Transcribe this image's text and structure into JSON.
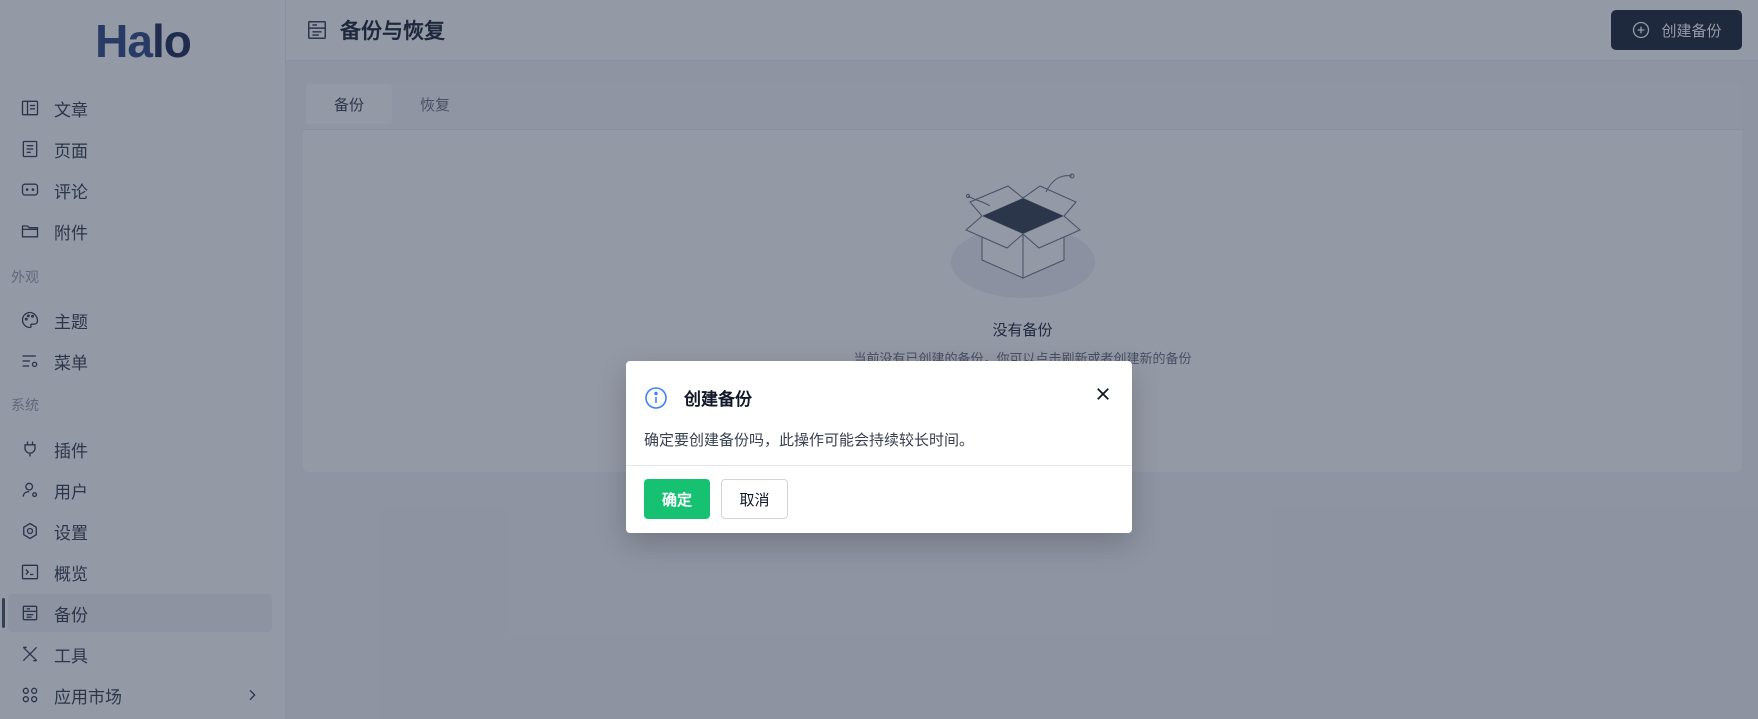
{
  "app": {
    "logo": "Halo"
  },
  "sidebar": {
    "items": [
      {
        "label": "文章",
        "icon": "article-icon"
      },
      {
        "label": "页面",
        "icon": "page-icon"
      },
      {
        "label": "评论",
        "icon": "comment-icon"
      },
      {
        "label": "附件",
        "icon": "folder-icon"
      },
      {
        "label": "主题",
        "icon": "palette-icon"
      },
      {
        "label": "菜单",
        "icon": "menu-settings-icon"
      },
      {
        "label": "插件",
        "icon": "plug-icon"
      },
      {
        "label": "用户",
        "icon": "user-icon"
      },
      {
        "label": "设置",
        "icon": "gear-icon"
      },
      {
        "label": "概览",
        "icon": "terminal-icon"
      },
      {
        "label": "备份",
        "icon": "backup-icon",
        "active": true
      },
      {
        "label": "工具",
        "icon": "tools-icon"
      },
      {
        "label": "应用市场",
        "icon": "apps-icon"
      }
    ],
    "groups": {
      "appearance": "外观",
      "system": "系统"
    }
  },
  "header": {
    "title": "备份与恢复",
    "create_button": "创建备份"
  },
  "tabs": [
    {
      "label": "备份",
      "active": true
    },
    {
      "label": "恢复",
      "active": false
    }
  ],
  "empty": {
    "title": "没有备份",
    "description": "当前没有已创建的备份，你可以点击刷新或者创建新的备份"
  },
  "modal": {
    "title": "创建备份",
    "message": "确定要创建备份吗，此操作可能会持续较长时间。",
    "confirm": "确定",
    "cancel": "取消"
  },
  "colors": {
    "primary_dark": "#1f2937",
    "success": "#16c172",
    "info": "#3b82f6",
    "overlay": "rgba(31,41,68,0.48)"
  }
}
